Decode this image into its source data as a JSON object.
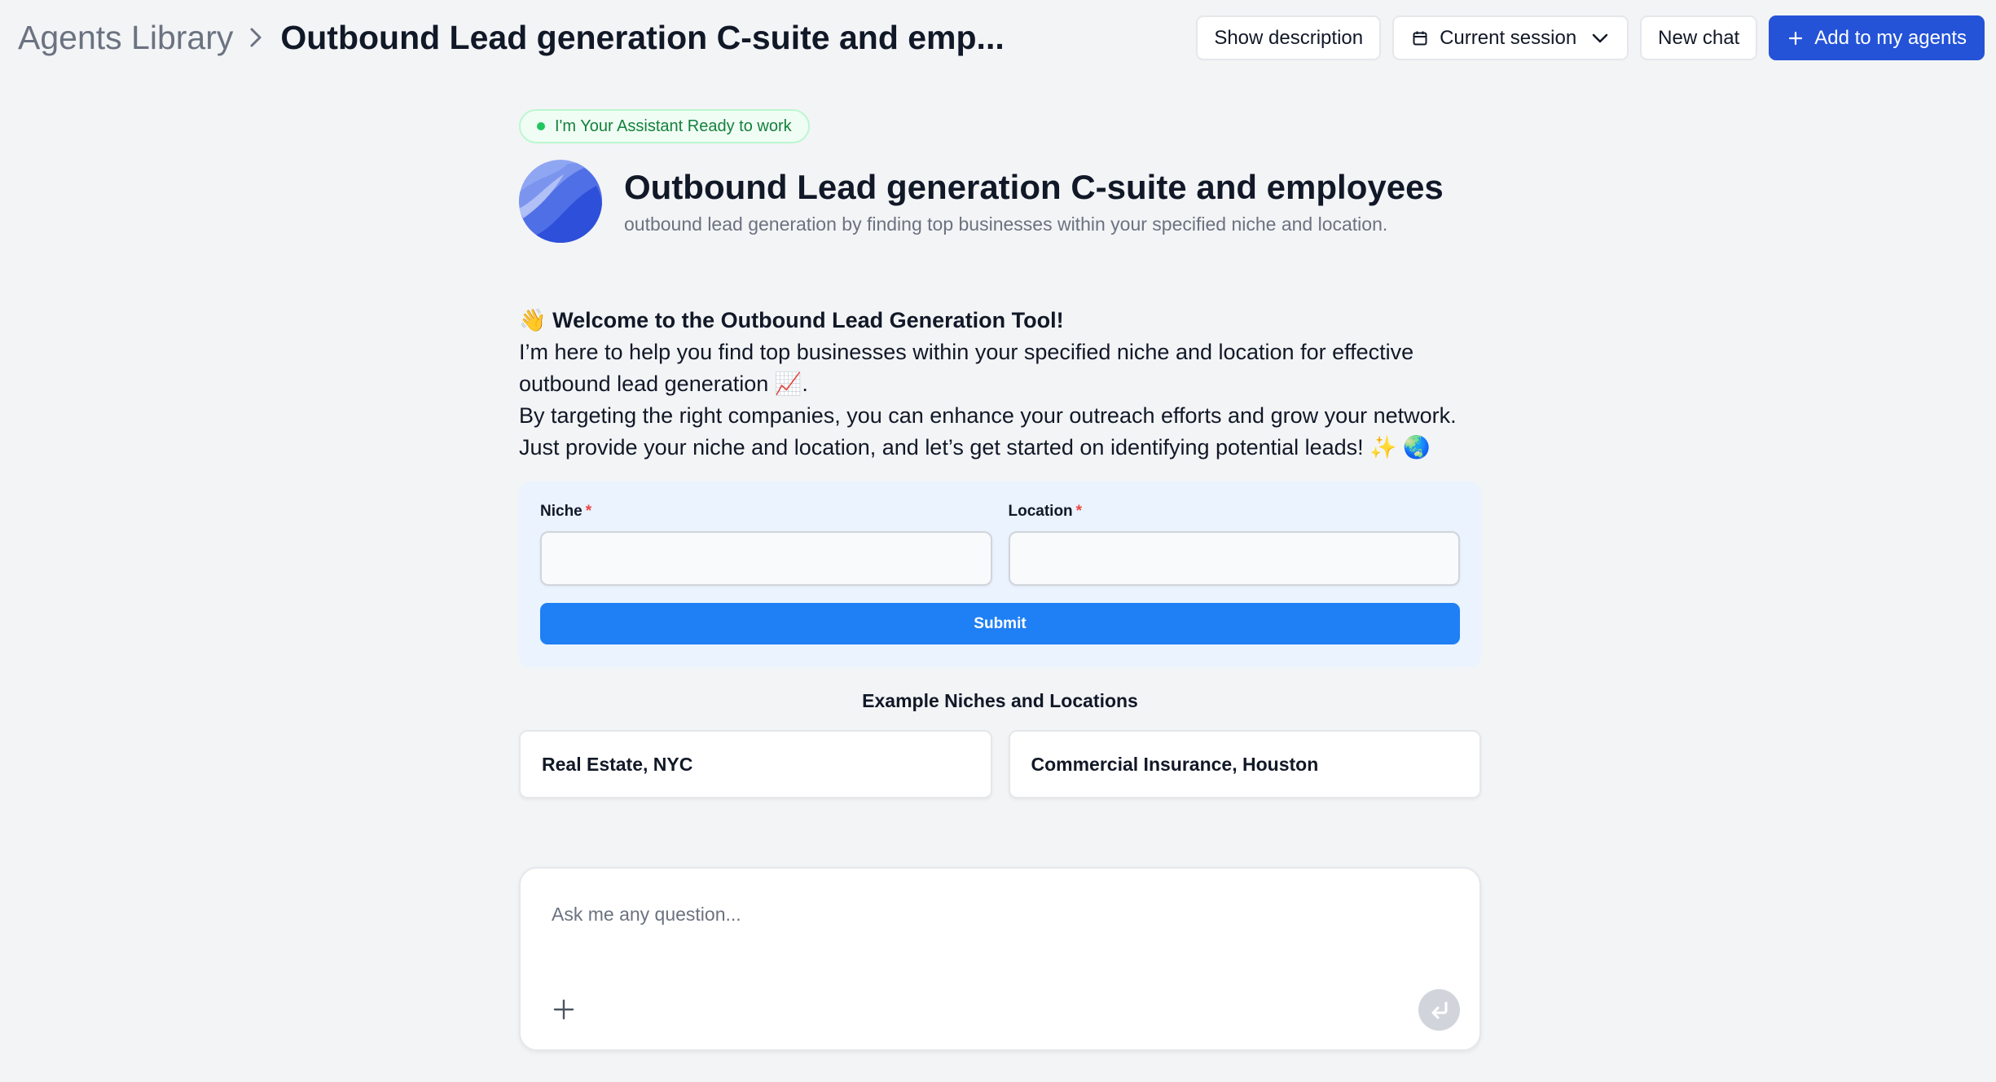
{
  "header": {
    "breadcrumb_root": "Agents Library",
    "title": "Outbound Lead generation C-suite and emp...",
    "buttons": {
      "show_description": "Show description",
      "current_session": "Current session",
      "new_chat": "New chat",
      "add_to_agents": "Add to my agents"
    }
  },
  "agent": {
    "status": "I'm Your Assistant Ready to work",
    "title": "Outbound Lead generation C-suite and employees",
    "subtitle": "outbound lead generation by finding top businesses within your specified niche and location."
  },
  "welcome": {
    "wave": "👋",
    "heading": "Welcome to the Outbound Lead Generation Tool!",
    "line1": "I’m here to help you find top businesses within your specified niche and location for effective outbound lead generation 📈.",
    "line2": "By targeting the right companies, you can enhance your outreach efforts and grow your network.",
    "line3": "Just provide your niche and location, and let’s get started on identifying potential leads! ✨ 🌏"
  },
  "form": {
    "niche_label": "Niche",
    "location_label": "Location",
    "required_mark": "*",
    "niche_value": "",
    "location_value": "",
    "submit_label": "Submit"
  },
  "examples": {
    "heading": "Example Niches and Locations",
    "items": [
      {
        "label": "Real Estate, NYC"
      },
      {
        "label": "Commercial Insurance, Houston"
      }
    ]
  },
  "chat": {
    "placeholder": "Ask me any question..."
  },
  "colors": {
    "background": "#f3f4f6",
    "primary": "#2453d8",
    "submit": "#1f7ff5",
    "form_background": "#eaf3fe",
    "status_green": "#15803d",
    "required_red": "#ef4444"
  },
  "icons": {
    "breadcrumb_separator": "chevron-right-icon",
    "session": "calendar-icon",
    "session_toggle": "chevron-down-icon",
    "add": "plus-icon",
    "attach": "plus-icon",
    "send": "enter-arrow-icon"
  }
}
